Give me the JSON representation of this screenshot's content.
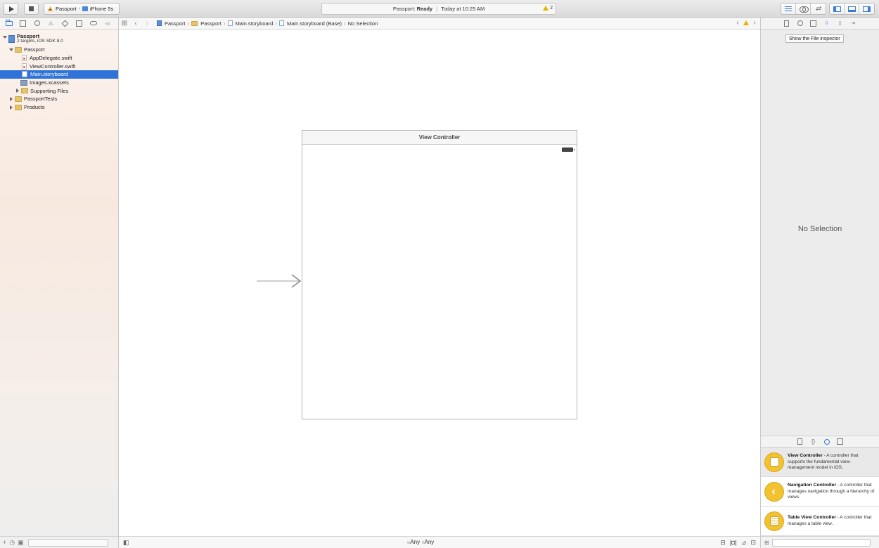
{
  "toolbar": {
    "scheme_project": "Passport",
    "scheme_device": "iPhone 5s",
    "activity_project": "Passport:",
    "activity_status": "Ready",
    "activity_time": "Today at 10:25 AM",
    "warning_count": "2",
    "icons": [
      "run-icon",
      "stop-icon",
      "standard-editor-icon",
      "assistant-editor-icon",
      "version-editor-icon",
      "navigator-toggle-icon",
      "debug-area-toggle-icon",
      "utilities-toggle-icon"
    ]
  },
  "navigator": {
    "tabs": [
      "project-navigator",
      "symbol-navigator",
      "find-navigator",
      "issue-navigator",
      "test-navigator",
      "debug-navigator",
      "breakpoint-navigator",
      "report-navigator"
    ],
    "project_name": "Passport",
    "project_subtitle": "2 targets, iOS SDK 8.0",
    "items": [
      {
        "label": "Passport",
        "kind": "group",
        "expanded": true
      },
      {
        "label": "AppDelegate.swift",
        "kind": "swift"
      },
      {
        "label": "ViewController.swift",
        "kind": "swift"
      },
      {
        "label": "Main.storyboard",
        "kind": "storyboard",
        "selected": true
      },
      {
        "label": "Images.xcassets",
        "kind": "assets"
      },
      {
        "label": "Supporting Files",
        "kind": "group",
        "expanded": false
      },
      {
        "label": "PassportTests",
        "kind": "group",
        "expanded": false
      },
      {
        "label": "Products",
        "kind": "group",
        "expanded": false
      }
    ]
  },
  "jumpbar": {
    "crumbs": [
      "Passport",
      "Passport",
      "Main.storyboard",
      "Main.storyboard (Base)",
      "No Selection"
    ]
  },
  "canvas": {
    "scene_title": "View Controller"
  },
  "editor_bottom": {
    "width_prefix": "w",
    "width_class": "Any",
    "height_prefix": "h",
    "height_class": "Any"
  },
  "inspector": {
    "tooltip": "Show the File inspector",
    "empty_label": "No Selection"
  },
  "library": {
    "items": [
      {
        "title": "View Controller",
        "desc": " - A controller that supports the fundamental view-management model in iOS."
      },
      {
        "title": "Navigation Controller",
        "desc": " - A controller that manages navigation through a hierarchy of views."
      },
      {
        "title": "Table View Controller",
        "desc": " - A controller that manages a table view."
      }
    ]
  },
  "colors": {
    "accent": "#2f73d8",
    "library_icon": "#f2c230",
    "warning": "#e7b400"
  }
}
